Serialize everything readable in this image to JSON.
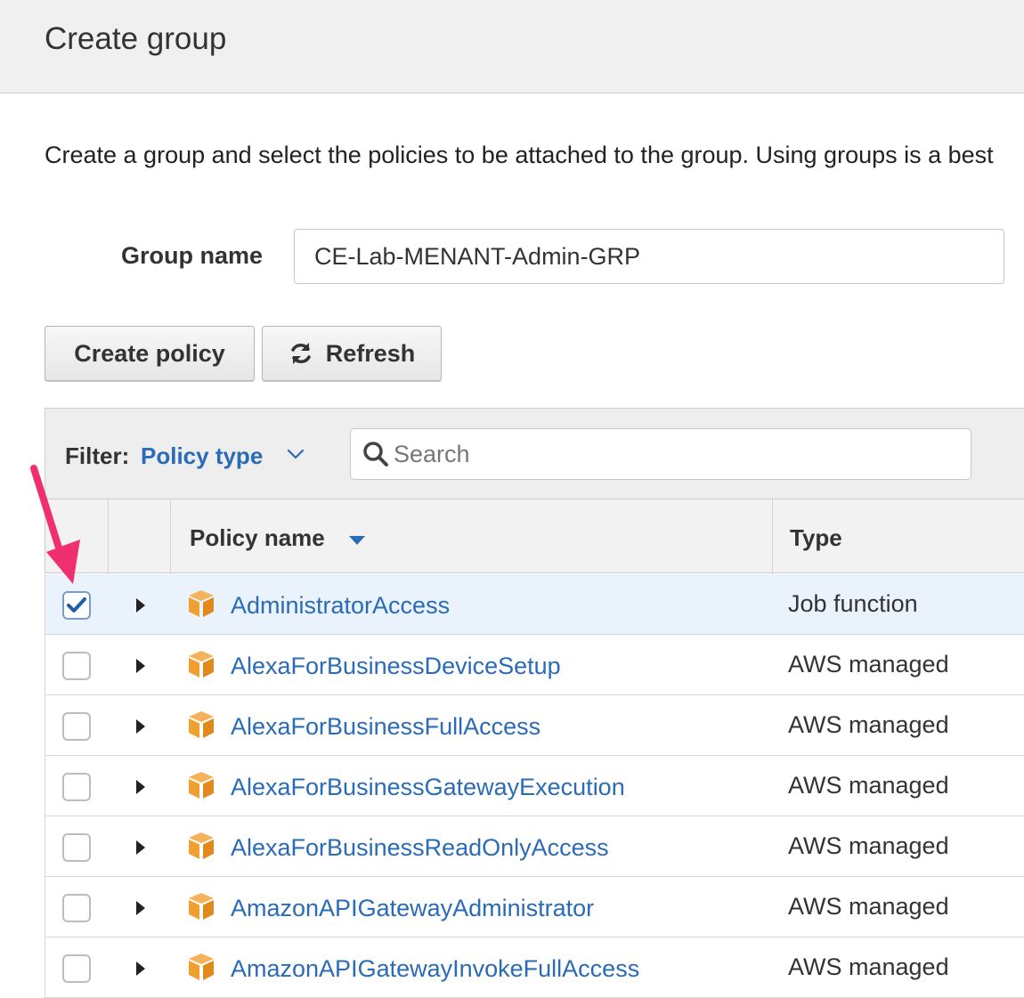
{
  "header": {
    "title": "Create group"
  },
  "intro": {
    "text": "Create a group and select the policies to be attached to the group. Using groups is a best"
  },
  "group_name": {
    "label": "Group name",
    "value": "CE-Lab-MENANT-Admin-GRP"
  },
  "toolbar": {
    "create_policy_label": "Create policy",
    "refresh_label": "Refresh"
  },
  "filter": {
    "label": "Filter:",
    "value": "Policy type",
    "search_placeholder": "Search"
  },
  "table": {
    "columns": {
      "policy_name": "Policy name",
      "type": "Type"
    },
    "rows": [
      {
        "name": "AdministratorAccess",
        "type": "Job function",
        "checked": true
      },
      {
        "name": "AlexaForBusinessDeviceSetup",
        "type": "AWS managed",
        "checked": false
      },
      {
        "name": "AlexaForBusinessFullAccess",
        "type": "AWS managed",
        "checked": false
      },
      {
        "name": "AlexaForBusinessGatewayExecution",
        "type": "AWS managed",
        "checked": false
      },
      {
        "name": "AlexaForBusinessReadOnlyAccess",
        "type": "AWS managed",
        "checked": false
      },
      {
        "name": "AmazonAPIGatewayAdministrator",
        "type": "AWS managed",
        "checked": false
      },
      {
        "name": "AmazonAPIGatewayInvokeFullAccess",
        "type": "AWS managed",
        "checked": false
      }
    ]
  },
  "icons": {
    "refresh": "refresh-icon",
    "search": "search-icon",
    "chevron": "chevron-down-icon",
    "sort": "sort-desc-icon",
    "policy": "policy-box-icon",
    "expand": "caret-right-icon",
    "annotation": "arrow-annotation"
  },
  "colors": {
    "link": "#2a6bb8",
    "selected_row": "#eaf2fb",
    "policy_icon": "#f0a030",
    "annotation_arrow": "#f0306e"
  }
}
